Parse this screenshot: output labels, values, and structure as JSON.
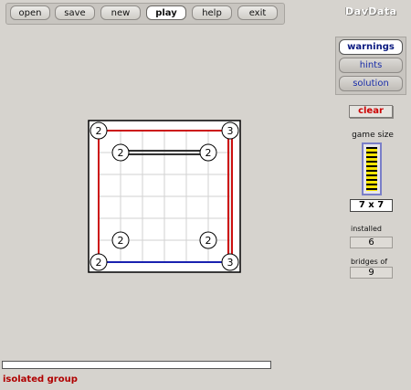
{
  "toolbar": {
    "buttons": [
      {
        "label": "open",
        "active": false
      },
      {
        "label": "save",
        "active": false
      },
      {
        "label": "new",
        "active": false
      },
      {
        "label": "play",
        "active": true
      },
      {
        "label": "help",
        "active": false
      },
      {
        "label": "exit",
        "active": false
      }
    ]
  },
  "logo": "DavData",
  "sidepanel": {
    "buttons": [
      {
        "label": "warnings",
        "active": true
      },
      {
        "label": "hints",
        "active": false
      },
      {
        "label": "solution",
        "active": false
      }
    ]
  },
  "clear_label": "clear",
  "game_size": {
    "label": "game size",
    "value": "7 x 7",
    "rows": 7,
    "cols": 7
  },
  "installed": {
    "label": "installed",
    "value": "6"
  },
  "bridges_of": {
    "label": "bridges of",
    "value": "9"
  },
  "board": {
    "islands": [
      {
        "id": "a",
        "row": 0,
        "col": 0,
        "value": "2"
      },
      {
        "id": "b",
        "row": 0,
        "col": 6,
        "value": "3"
      },
      {
        "id": "c",
        "row": 1,
        "col": 1,
        "value": "2"
      },
      {
        "id": "d",
        "row": 1,
        "col": 5,
        "value": "2"
      },
      {
        "id": "e",
        "row": 5,
        "col": 1,
        "value": "2"
      },
      {
        "id": "f",
        "row": 5,
        "col": 5,
        "value": "2"
      },
      {
        "id": "g",
        "row": 6,
        "col": 0,
        "value": "2"
      },
      {
        "id": "h",
        "row": 6,
        "col": 6,
        "value": "3"
      }
    ],
    "bridges": [
      {
        "from": "a",
        "to": "b",
        "count": 1,
        "color": "#cc1111"
      },
      {
        "from": "a",
        "to": "g",
        "count": 1,
        "color": "#cc1111"
      },
      {
        "from": "b",
        "to": "h",
        "count": 2,
        "color": "#cc1111"
      },
      {
        "from": "g",
        "to": "h",
        "count": 1,
        "color": "#1a22b0"
      },
      {
        "from": "c",
        "to": "d",
        "count": 2,
        "color": "#333333"
      }
    ],
    "colors": {
      "grid": "#d2d2d2",
      "island_fill": "#ffffff",
      "island_stroke": "#000000"
    }
  },
  "progress": {
    "fraction": 0
  },
  "status": "isolated group"
}
